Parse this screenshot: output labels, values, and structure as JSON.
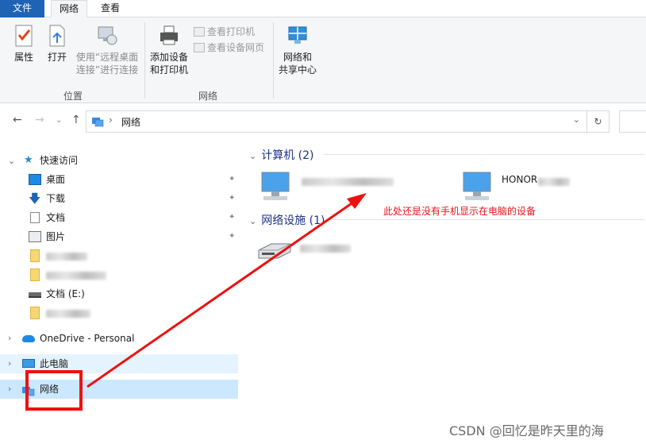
{
  "ribbon_tabs": {
    "file": "文件",
    "network": "网络",
    "view": "查看"
  },
  "ribbon": {
    "properties": "属性",
    "open": "打开",
    "remote_desktop_line1": "使用“远程桌面",
    "remote_desktop_line2": "连接”进行连接",
    "group_location": "位置",
    "add_device_line1": "添加设备",
    "add_device_line2": "和打印机",
    "view_printers": "查看打印机",
    "view_device_webpage": "查看设备网页",
    "group_network": "网络",
    "net_center_line1": "网络和",
    "net_center_line2": "共享中心"
  },
  "address_bar": {
    "path": "网络",
    "separator": "›"
  },
  "sidebar": {
    "quick_access": "快速访问",
    "items": [
      {
        "label": "桌面",
        "icon": "desktop-icon"
      },
      {
        "label": "下载",
        "icon": "download-icon"
      },
      {
        "label": "文档",
        "icon": "document-icon"
      },
      {
        "label": "图片",
        "icon": "picture-icon"
      },
      {
        "label": "文档 (E:)",
        "icon": "drive-icon"
      }
    ],
    "onedrive": "OneDrive - Personal",
    "this_pc": "此电脑",
    "network": "网络"
  },
  "content": {
    "computers_header": "计算机 (2)",
    "computer_2_label_prefix": "HONOR",
    "devices_header": "网络设施 (1)"
  },
  "annotation": "此处还是没有手机显示在电脑的设备",
  "watermark": "CSDN @回忆是昨天里的海",
  "colors": {
    "accent": "#1e63b4",
    "selected": "#cce8ff",
    "annotation": "#e8141b",
    "header": "#1e3287"
  }
}
